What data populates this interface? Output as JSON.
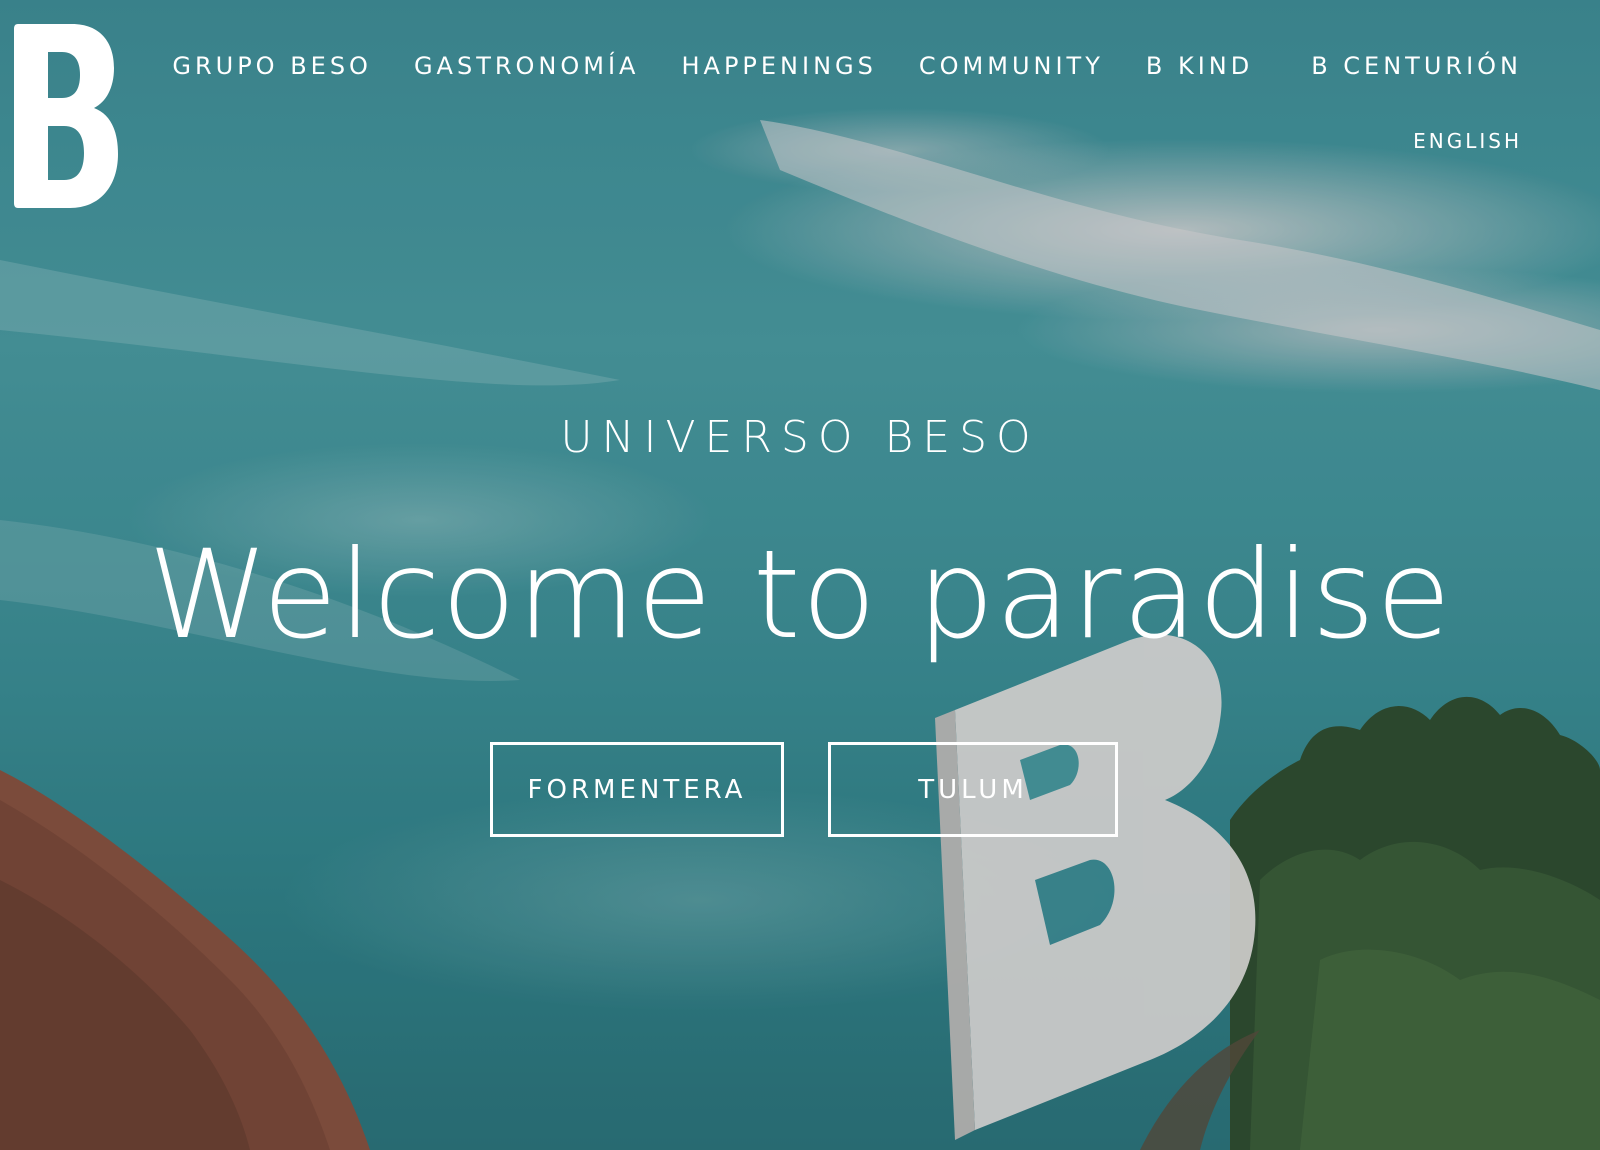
{
  "colors": {
    "text": "#ffffff",
    "sky": "#3f8d96",
    "logo": "#ffffff"
  },
  "logo": {
    "text": "B",
    "icon": "b-logo-icon"
  },
  "nav": {
    "items": [
      "GRUPO BESO",
      "GASTRONOMÍA",
      "HAPPENINGS",
      "COMMUNITY",
      "B KIND",
      "B CENTURIÓN"
    ],
    "language": "ENGLISH"
  },
  "hero": {
    "eyebrow": "UNIVERSO BESO",
    "title": "Welcome to paradise",
    "buttons": {
      "formentera": "FORMENTERA",
      "tulum": "TULUM"
    }
  }
}
